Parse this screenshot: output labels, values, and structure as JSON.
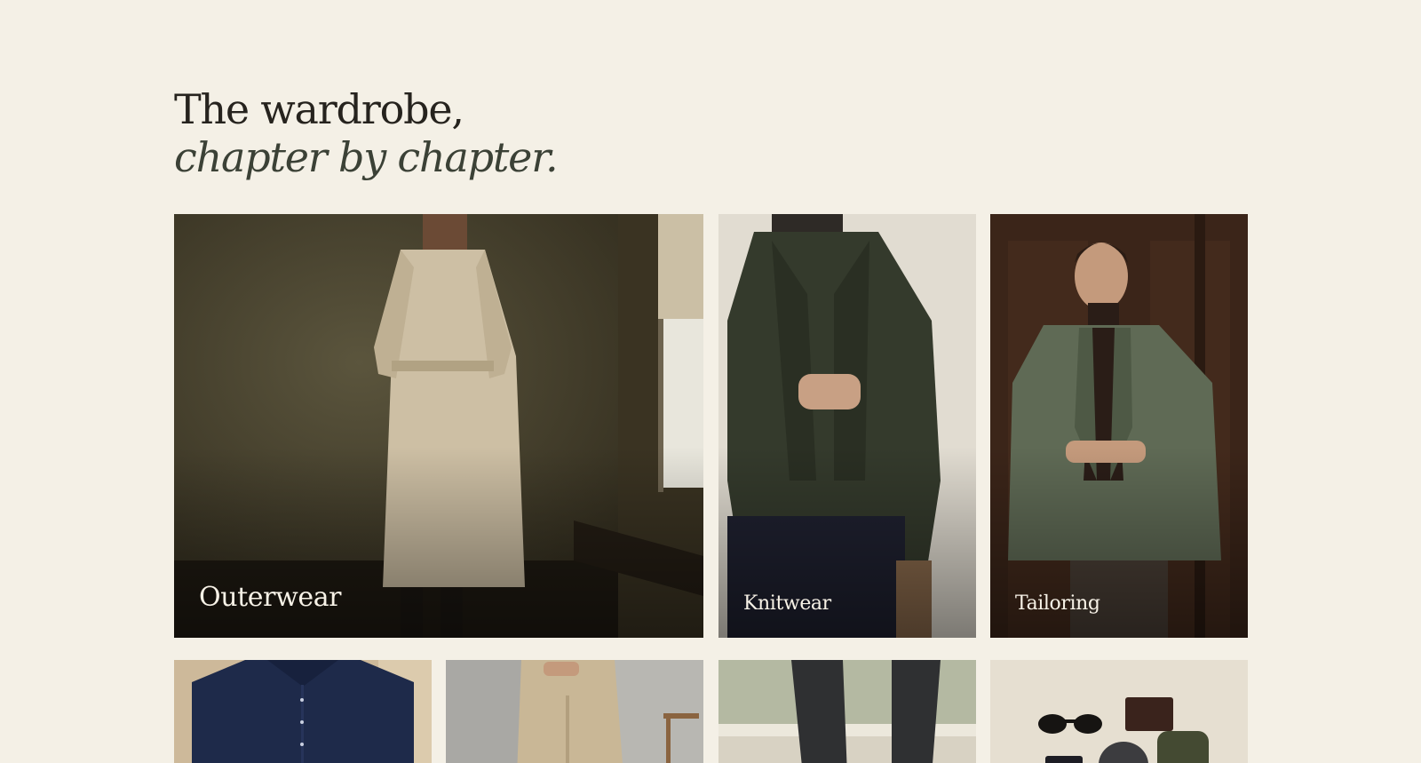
{
  "heading": {
    "line1": "The wardrobe,",
    "line2": "chapter by chapter."
  },
  "categories": [
    {
      "label": "Outerwear"
    },
    {
      "label": "Knitwear"
    },
    {
      "label": "Tailoring"
    }
  ],
  "colors": {
    "background": "#f4f0e6",
    "heading": "#26231e",
    "heading_italic": "#3b4136",
    "label": "#f7f2e7"
  }
}
